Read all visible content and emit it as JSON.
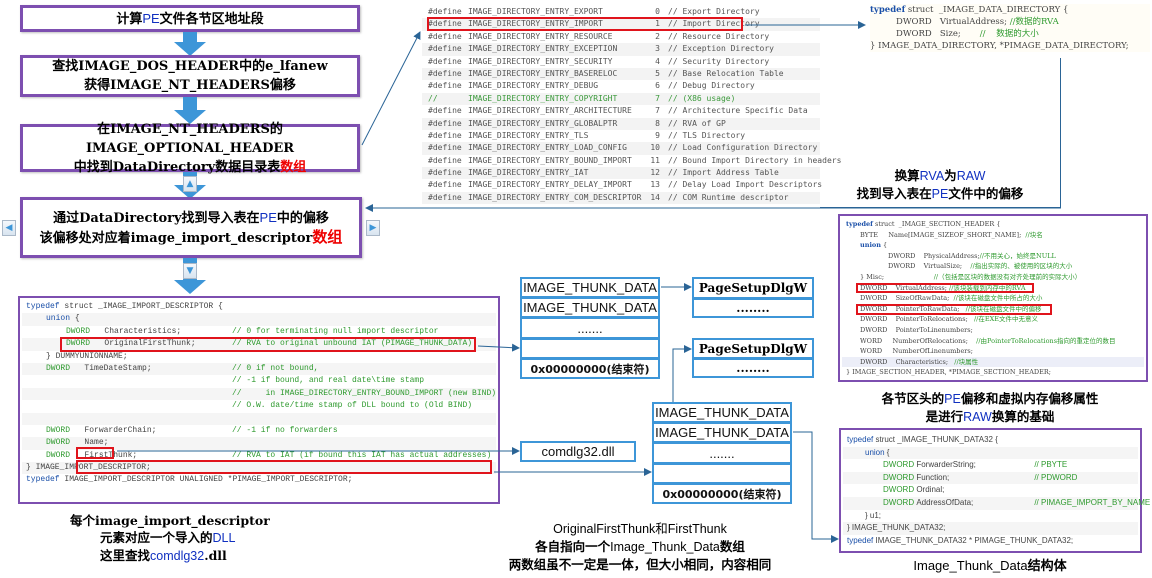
{
  "flow": {
    "step1": {
      "pre": "计算",
      "pe": "PE",
      "post": "文件各节区地址段"
    },
    "step2": {
      "line1": "查找IMAGE_DOS_HEADER中的e_lfanew",
      "line2": "获得IMAGE_NT_HEADERS偏移"
    },
    "step3": {
      "line1": "在IMAGE_NT_HEADERS的IMAGE_OPTIONAL_HEADER",
      "line2_pre": "中找到DataDirectory数据目录表",
      "line2_red": "数组"
    },
    "step4": {
      "line1_pre": "通过DataDirectory找到导入表在",
      "line1_pe": "PE",
      "line1_post": "中的偏移",
      "line2_pre": "该偏移处对应着image_import_descriptor",
      "line2_red": "数组"
    },
    "nav_prev_icon": "left-triangle",
    "nav_next_icon": "right-triangle",
    "collapse_up_icon": "up-triangle",
    "collapse_down_icon": "down-triangle"
  },
  "data_directory_defines": [
    {
      "prefix": "#define",
      "name": "IMAGE_DIRECTORY_ENTRY_EXPORT",
      "index": "0",
      "comment": "// Export Directory"
    },
    {
      "prefix": "#define",
      "name": "IMAGE_DIRECTORY_ENTRY_IMPORT",
      "index": "1",
      "comment": "// Import Directory"
    },
    {
      "prefix": "#define",
      "name": "IMAGE_DIRECTORY_ENTRY_RESOURCE",
      "index": "2",
      "comment": "// Resource Directory"
    },
    {
      "prefix": "#define",
      "name": "IMAGE_DIRECTORY_ENTRY_EXCEPTION",
      "index": "3",
      "comment": "// Exception Directory"
    },
    {
      "prefix": "#define",
      "name": "IMAGE_DIRECTORY_ENTRY_SECURITY",
      "index": "4",
      "comment": "// Security Directory"
    },
    {
      "prefix": "#define",
      "name": "IMAGE_DIRECTORY_ENTRY_BASERELOC",
      "index": "5",
      "comment": "// Base Relocation Table"
    },
    {
      "prefix": "#define",
      "name": "IMAGE_DIRECTORY_ENTRY_DEBUG",
      "index": "6",
      "comment": "// Debug Directory"
    },
    {
      "prefix": "//     ",
      "name": "IMAGE_DIRECTORY_ENTRY_COPYRIGHT",
      "index": "7",
      "comment": "// (X86 usage)"
    },
    {
      "prefix": "#define",
      "name": "IMAGE_DIRECTORY_ENTRY_ARCHITECTURE",
      "index": "7",
      "comment": "// Architecture Specific Data"
    },
    {
      "prefix": "#define",
      "name": "IMAGE_DIRECTORY_ENTRY_GLOBALPTR",
      "index": "8",
      "comment": "// RVA of GP"
    },
    {
      "prefix": "#define",
      "name": "IMAGE_DIRECTORY_ENTRY_TLS",
      "index": "9",
      "comment": "// TLS Directory"
    },
    {
      "prefix": "#define",
      "name": "IMAGE_DIRECTORY_ENTRY_LOAD_CONFIG",
      "index": "10",
      "comment": "// Load Configuration Directory"
    },
    {
      "prefix": "#define",
      "name": "IMAGE_DIRECTORY_ENTRY_BOUND_IMPORT",
      "index": "11",
      "comment": "// Bound Import Directory in headers"
    },
    {
      "prefix": "#define",
      "name": "IMAGE_DIRECTORY_ENTRY_IAT",
      "index": "12",
      "comment": "// Import Address Table"
    },
    {
      "prefix": "#define",
      "name": "IMAGE_DIRECTORY_ENTRY_DELAY_IMPORT",
      "index": "13",
      "comment": "// Delay Load Import Descriptors"
    },
    {
      "prefix": "#define",
      "name": "IMAGE_DIRECTORY_ENTRY_COM_DESCRIPTOR",
      "index": "14",
      "comment": "// COM Runtime descriptor"
    }
  ],
  "data_directory_struct": {
    "l1_kw": "typedef",
    "l1_rest": " struct  _IMAGE_DATA_DIRECTORY {",
    "l2_type": "DWORD",
    "l2_field": "VirtualAddress;",
    "l2_comment": "//数据的RVA",
    "l3_type": "DWORD",
    "l3_field": "Size;",
    "l3_comment": "//    数据的大小",
    "l4": "} IMAGE_DATA_DIRECTORY, *PIMAGE_DATA_DIRECTORY;"
  },
  "rva_caption": {
    "l1_pre": "换算",
    "l1_rva": "RVA",
    "l1_mid": "为",
    "l1_raw": "RAW",
    "l2_pre": "找到导入表在",
    "l2_pe": "PE",
    "l2_post": "文件中的偏移"
  },
  "section_header_struct": [
    {
      "indent": 0,
      "kw": "typedef",
      "text": " struct  _IMAGE_SECTION_HEADER {",
      "comment": ""
    },
    {
      "indent": 1,
      "kw": "",
      "text": "BYTE     Name[IMAGE_SIZEOF_SHORT_NAME];",
      "comment": "  //块名"
    },
    {
      "indent": 1,
      "kw": "union",
      "text": " {",
      "comment": ""
    },
    {
      "indent": 3,
      "kw": "",
      "text": "DWORD    PhysicalAddress;",
      "comment": "//不用关心，始终是NULL"
    },
    {
      "indent": 3,
      "kw": "",
      "text": "DWORD    VirtualSize;",
      "comment": "    //指出实际的、被使用的区块的大小"
    },
    {
      "indent": 1,
      "kw": "",
      "text": "} Misc;",
      "comment": "                        //（包括是区块的数据没有对齐处理前的实际大小）"
    },
    {
      "indent": 1,
      "kw": "",
      "text": "DWORD    VirtualAddress;",
      "comment": " //该块装载到内存中的RVA"
    },
    {
      "indent": 1,
      "kw": "",
      "text": "DWORD    SizeOfRawData;",
      "comment": "  //该块在磁盘文件中所占的大小"
    },
    {
      "indent": 1,
      "kw": "",
      "text": "DWORD    PointerToRawData;",
      "comment": "   //该块在磁盘文件中的偏移"
    },
    {
      "indent": 1,
      "kw": "",
      "text": "DWORD    PointerToRelocations;",
      "comment": "   //在EXE文件中无意义"
    },
    {
      "indent": 1,
      "kw": "",
      "text": "DWORD    PointerToLinenumbers;",
      "comment": ""
    },
    {
      "indent": 1,
      "kw": "",
      "text": "WORD     NumberOfRelocations;",
      "comment": "    //由PointerToRelocations指向的重定位的数目"
    },
    {
      "indent": 1,
      "kw": "",
      "text": "WORD     NumberOfLinenumbers;",
      "comment": ""
    },
    {
      "indent": 1,
      "kw": "",
      "text": "DWORD    Characteristics;",
      "comment": "   //块属性"
    },
    {
      "indent": 0,
      "kw": "",
      "text": "} IMAGE_SECTION_HEADER, *PIMAGE_SECTION_HEADER;",
      "comment": ""
    }
  ],
  "section_caption": {
    "l1_pre": "各节区头的",
    "l1_pe": "PE",
    "l1_post": "偏移和虚拟内存偏移属性",
    "l2_pre": "是进行",
    "l2_raw": "RAW",
    "l2_post": "换算的基础"
  },
  "import_descriptor_struct": [
    {
      "indent": 0,
      "kw": "typedef",
      "type": "",
      "text": " struct _IMAGE_IMPORT_DESCRIPTOR {",
      "comment": ""
    },
    {
      "indent": 1,
      "kw": "union",
      "type": "",
      "text": " {",
      "comment": ""
    },
    {
      "indent": 2,
      "kw": "",
      "type": "DWORD",
      "text": "   Characteristics;",
      "comment": "// 0 for terminating null import descriptor"
    },
    {
      "indent": 2,
      "kw": "",
      "type": "DWORD",
      "text": "   OriginalFirstThunk;",
      "comment": "// RVA to original unbound IAT (PIMAGE_THUNK_DATA)"
    },
    {
      "indent": 1,
      "kw": "",
      "type": "",
      "text": "} DUMMYUNIONNAME;",
      "comment": ""
    },
    {
      "indent": 1,
      "kw": "",
      "type": "DWORD",
      "text": "   TimeDateStamp;",
      "comment": "// 0 if not bound,"
    },
    {
      "indent": 1,
      "kw": "",
      "type": "",
      "text": "",
      "comment": "// -1 if bound, and real date\\time stamp"
    },
    {
      "indent": 1,
      "kw": "",
      "type": "",
      "text": "",
      "comment": "//     in IMAGE_DIRECTORY_ENTRY_BOUND_IMPORT (new BIND)"
    },
    {
      "indent": 1,
      "kw": "",
      "type": "",
      "text": "",
      "comment": "// O.W. date/time stamp of DLL bound to (Old BIND)"
    },
    {
      "indent": 1,
      "kw": "",
      "type": "",
      "text": "",
      "comment": ""
    },
    {
      "indent": 1,
      "kw": "",
      "type": "DWORD",
      "text": "   ForwarderChain;",
      "comment": "// -1 if no forwarders"
    },
    {
      "indent": 1,
      "kw": "",
      "type": "DWORD",
      "text": "   Name;",
      "comment": ""
    },
    {
      "indent": 1,
      "kw": "",
      "type": "DWORD",
      "text": "   FirstThunk;",
      "comment": "// RVA to IAT (if bound this IAT has actual addresses)"
    },
    {
      "indent": 0,
      "kw": "",
      "type": "",
      "text": "} IMAGE_IMPORT_DESCRIPTOR;",
      "comment": ""
    },
    {
      "indent": 0,
      "kw": "typedef",
      "type": "",
      "text": " IMAGE_IMPORT_DESCRIPTOR UNALIGNED *PIMAGE_IMPORT_DESCRIPTOR;",
      "comment": ""
    }
  ],
  "descriptor_caption": {
    "l1": "每个image_import_descriptor",
    "l2_pre": "元素对应一个导入的",
    "l2_dll": "DLL",
    "l3_pre": "这里查找",
    "l3_name": "comdlg32",
    "l3_post": ".dll"
  },
  "thunk_array_1": [
    "IMAGE_THUNK_DATA",
    "IMAGE_THUNK_DATA",
    ".......",
    "",
    "0x00000000(结束符)"
  ],
  "thunk_array_2": [
    "IMAGE_THUNK_DATA",
    "IMAGE_THUNK_DATA",
    ".......",
    "",
    "0x00000000(结束符)"
  ],
  "import_by_name_1": [
    "PageSetupDlgW",
    "........"
  ],
  "import_by_name_2": [
    "PageSetupDlgW",
    "........"
  ],
  "dll_name_box": "comdlg32.dll",
  "thunk_caption": {
    "l1": "OriginalFirstThunk和FirstThunk",
    "l2_pre": "各自指向一个",
    "l2_mid": "Image_Thunk_Data",
    "l2_post": "数组",
    "l3": "两数组虽不一定是一体，但大小相同，内容相同"
  },
  "thunk_data32_struct": [
    {
      "indent": 0,
      "kw": "typedef",
      "text": " struct _IMAGE_THUNK_DATA32 {",
      "comment": ""
    },
    {
      "indent": 1,
      "kw": "union",
      "text": " {",
      "comment": ""
    },
    {
      "indent": 2,
      "kw": "",
      "text": "ForwarderString;",
      "dw": "DWORD ",
      "comment": "// PBYTE"
    },
    {
      "indent": 2,
      "kw": "",
      "text": "Function;",
      "dw": "DWORD ",
      "comment": "// PDWORD"
    },
    {
      "indent": 2,
      "kw": "",
      "text": "Ordinal;",
      "dw": "DWORD ",
      "comment": ""
    },
    {
      "indent": 2,
      "kw": "",
      "text": "AddressOfData;",
      "dw": "DWORD ",
      "comment": "// PIMAGE_IMPORT_BY_NAME"
    },
    {
      "indent": 1,
      "kw": "",
      "text": "} u1;",
      "dw": "",
      "comment": ""
    },
    {
      "indent": 0,
      "kw": "",
      "text": "} IMAGE_THUNK_DATA32;",
      "dw": "",
      "comment": ""
    },
    {
      "indent": 0,
      "kw": "typedef",
      "text": " IMAGE_THUNK_DATA32 * PIMAGE_THUNK_DATA32;",
      "dw": "",
      "comment": ""
    }
  ],
  "thunk_struct_caption": {
    "pre": "Image_Thunk_Data",
    "post": "结构体"
  },
  "colors": {
    "purple_border": "#7d4fb0",
    "arrow_blue": "#3d96d8",
    "highlight_red": "#e0141c",
    "line_blue": "#2a6496"
  }
}
